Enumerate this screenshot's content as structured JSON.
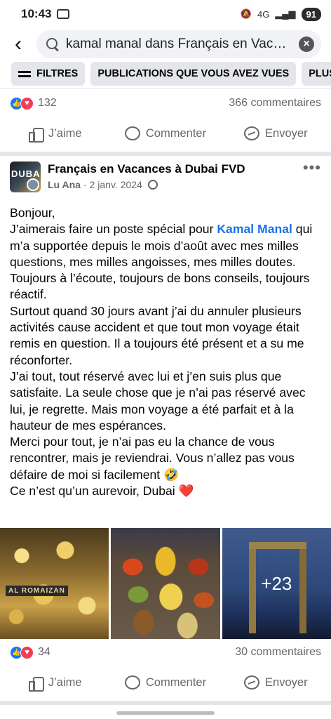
{
  "status_bar": {
    "time": "10:43",
    "network": "4G",
    "battery": "91"
  },
  "search": {
    "query": "kamal manal dans Français en Vacances à Dubai FVD"
  },
  "filters": {
    "chips": [
      "FILTRES",
      "PUBLICATIONS QUE VOUS AVEZ VUES",
      "PLUS RÉCENTS"
    ]
  },
  "prev_post": {
    "reactions_count": "132",
    "comments": "366 commentaires"
  },
  "actions": {
    "like": "J’aime",
    "comment": "Commenter",
    "share": "Envoyer"
  },
  "post": {
    "group": "Français en Vacances à Dubai FVD",
    "author": "Lu Ana",
    "date": "2 janv. 2024",
    "avatar_text": "DUBA",
    "body": {
      "p1": "Bonjour,",
      "p2_before": "J’aimerais faire un poste spécial pour ",
      "mention": "Kamal Manal",
      "p2_after": " qui m’a supportée depuis le mois d’août avec mes milles questions, mes milles angoisses, mes milles doutes. Toujours à l’écoute, toujours de bons conseils, toujours réactif.",
      "p3": "Surtout quand 30 jours avant j’ai du annuler plusieurs activités cause accident et que tout mon voyage était remis en question. Il a toujours été présent et a su me réconforter.",
      "p4": "J’ai tout, tout réservé avec lui et j’en suis plus que satisfaite. La seule chose que je n’ai pas réservé avec lui, je regrette. Mais mon voyage a été parfait et à la hauteur de mes espérances.",
      "p5": "Merci pour tout, je n’ai pas eu la chance de vous rencontrer, mais je reviendrai. Vous n’allez pas vous défaire de moi si facilement 🤣",
      "p6": "Ce n’est qu’un aurevoir, Dubai",
      "heart": "❤️"
    },
    "photos": {
      "shop_sign": "AL ROMAIZAN",
      "more_count": "+23"
    },
    "reactions_count": "34",
    "comments": "30 commentaires"
  }
}
